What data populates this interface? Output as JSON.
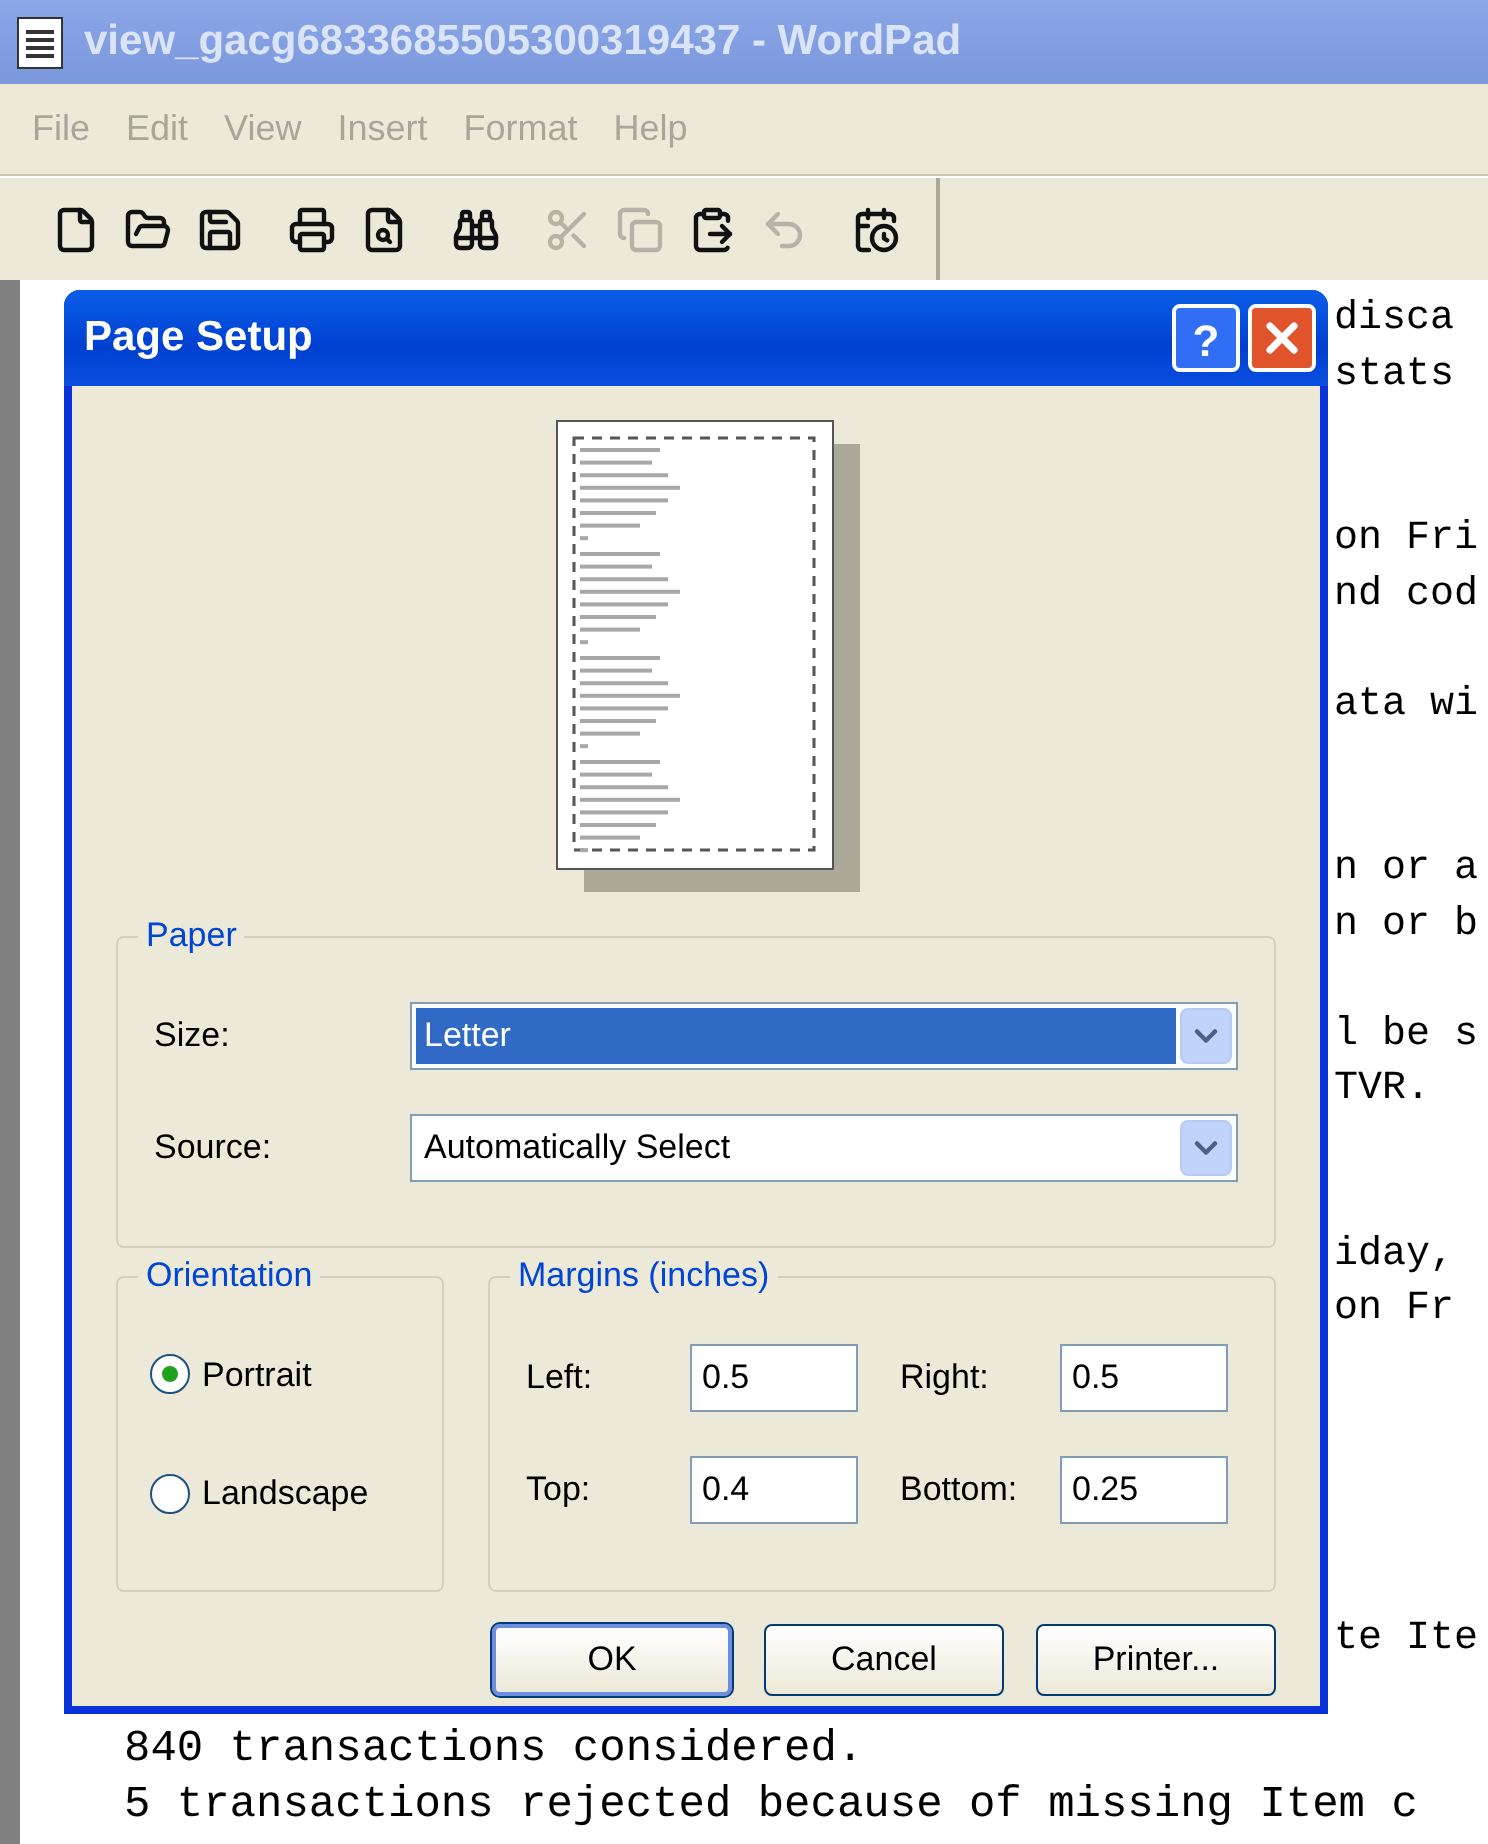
{
  "window": {
    "title": "view_gacg6833685505300319437 - WordPad"
  },
  "menu": [
    "File",
    "Edit",
    "View",
    "Insert",
    "Format",
    "Help"
  ],
  "toolbar": [
    [
      {
        "disabled": false
      },
      {
        "disabled": false
      },
      {
        "disabled": false
      }
    ],
    [
      {
        "disabled": false
      },
      {
        "disabled": false
      }
    ],
    [
      {
        "disabled": false
      }
    ],
    [
      {
        "disabled": true
      },
      {
        "disabled": true
      },
      {
        "disabled": false
      },
      {
        "disabled": true
      }
    ],
    [
      {
        "disabled": false
      }
    ]
  ],
  "document": {
    "lines": [
      {
        "kind": "text",
        "text": "disca"
      },
      {
        "kind": "text",
        "text": "stats"
      },
      {
        "kind": "blank"
      },
      {
        "kind": "blank"
      },
      {
        "kind": "text",
        "text": "on Fri"
      },
      {
        "kind": "text",
        "text": "nd cod"
      },
      {
        "kind": "blank"
      },
      {
        "kind": "text",
        "text": "ata wi"
      },
      {
        "kind": "blank"
      },
      {
        "kind": "blank"
      },
      {
        "kind": "text",
        "text": "n or a"
      },
      {
        "kind": "text",
        "text": "n or b"
      },
      {
        "kind": "blank"
      },
      {
        "kind": "text",
        "text": "l be s"
      },
      {
        "kind": "text",
        "text": "TVR."
      },
      {
        "kind": "blank"
      },
      {
        "kind": "blank"
      },
      {
        "kind": "text",
        "text": "iday,"
      },
      {
        "kind": "text",
        "text": "on Fr"
      },
      {
        "kind": "blank"
      },
      {
        "kind": "blank"
      },
      {
        "kind": "blank"
      },
      {
        "kind": "blank"
      },
      {
        "kind": "blank"
      },
      {
        "kind": "text",
        "text": "te Ite"
      },
      {
        "kind": "blank"
      },
      {
        "kind": "full",
        "text": "840 transactions considered."
      },
      {
        "kind": "full",
        "text": "5 transactions rejected because of missing Item c"
      }
    ]
  },
  "dialog": {
    "title": "Page Setup",
    "help_button": "?",
    "paper": {
      "legend": "Paper",
      "size": {
        "label": "Size:",
        "value": "Letter",
        "focused": true
      },
      "source": {
        "label": "Source:",
        "value": "Automatically Select",
        "focused": false
      }
    },
    "orientation": {
      "legend": "Orientation",
      "options": [
        {
          "label": "Portrait",
          "selected": true
        },
        {
          "label": "Landscape",
          "selected": false
        }
      ]
    },
    "margins": {
      "legend": "Margins (inches)",
      "fields": [
        {
          "label": "Left:",
          "value": "0.5"
        },
        {
          "label": "Right:",
          "value": "0.5"
        },
        {
          "label": "Top:",
          "value": "0.4"
        },
        {
          "label": "Bottom:",
          "value": "0.25"
        }
      ]
    },
    "buttons": [
      {
        "label": "OK",
        "default": true
      },
      {
        "label": "Cancel",
        "default": false
      },
      {
        "label": "Printer...",
        "default": false
      }
    ]
  }
}
